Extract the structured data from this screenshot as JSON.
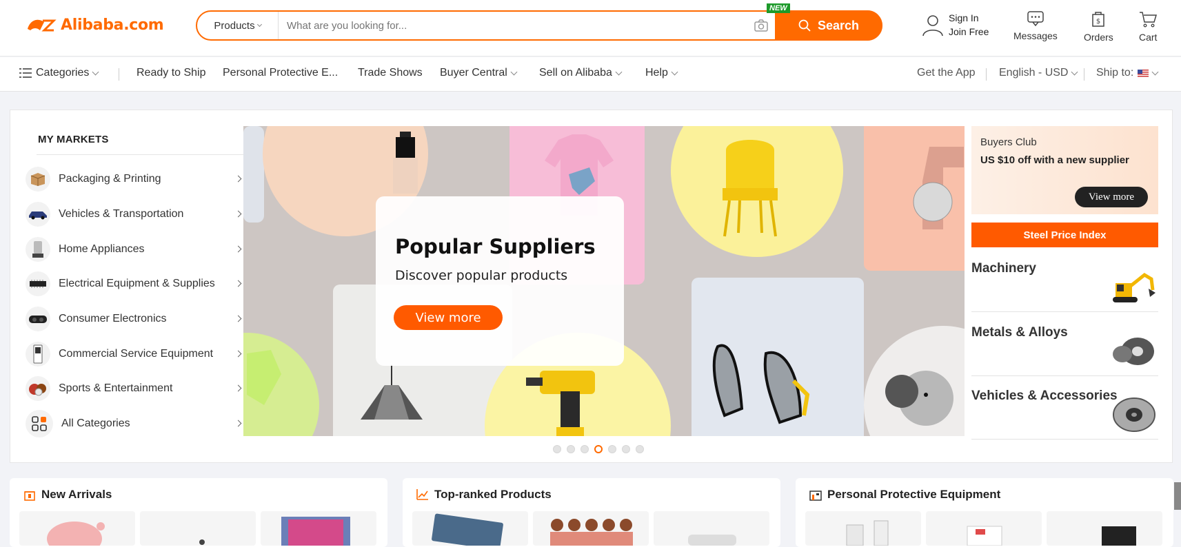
{
  "header": {
    "logo_text": "Alibaba.com",
    "search_category": "Products",
    "search_placeholder": "What are you looking for...",
    "new_badge": "NEW",
    "search_button": "Search",
    "sign_in": "Sign In",
    "join_free": "Join Free",
    "messages": "Messages",
    "orders": "Orders",
    "cart": "Cart"
  },
  "nav": {
    "categories": "Categories",
    "ready_to_ship": "Ready to Ship",
    "ppe": "Personal Protective E...",
    "trade_shows": "Trade Shows",
    "buyer_central": "Buyer Central",
    "sell_on_alibaba": "Sell on Alibaba",
    "help": "Help",
    "get_the_app": "Get the App",
    "language": "English - USD",
    "ship_to": "Ship to:"
  },
  "markets": {
    "title": "MY MARKETS",
    "items": [
      {
        "label": "Packaging & Printing",
        "icon": "box-icon"
      },
      {
        "label": "Vehicles & Transportation",
        "icon": "car-icon"
      },
      {
        "label": "Home Appliances",
        "icon": "juicer-icon"
      },
      {
        "label": "Electrical Equipment & Supplies",
        "icon": "chip-icon"
      },
      {
        "label": "Consumer Electronics",
        "icon": "vr-headset-icon"
      },
      {
        "label": "Commercial Service Equipment",
        "icon": "kiosk-icon"
      },
      {
        "label": "Sports & Entertainment",
        "icon": "balls-icon"
      },
      {
        "label": "All Categories",
        "icon": "grid-icon"
      }
    ]
  },
  "banner": {
    "title": "Popular Suppliers",
    "subtitle": "Discover popular products",
    "button": "View more",
    "slide_count": 7,
    "active_slide": 4
  },
  "side": {
    "buyers_title": "Buyers Club",
    "buyers_offer": "US $10 off with a new supplier",
    "buyers_button": "View more",
    "steel_index": "Steel Price Index",
    "categories": [
      "Machinery",
      "Metals & Alloys",
      "Vehicles & Accessories"
    ]
  },
  "sections": {
    "new_arrivals": "New Arrivals",
    "top_ranked": "Top-ranked Products",
    "ppe": "Personal Protective Equipment"
  },
  "colors": {
    "brand": "#ff6a00",
    "accent": "#ff5a00",
    "badge_green": "#1d9a2a"
  }
}
